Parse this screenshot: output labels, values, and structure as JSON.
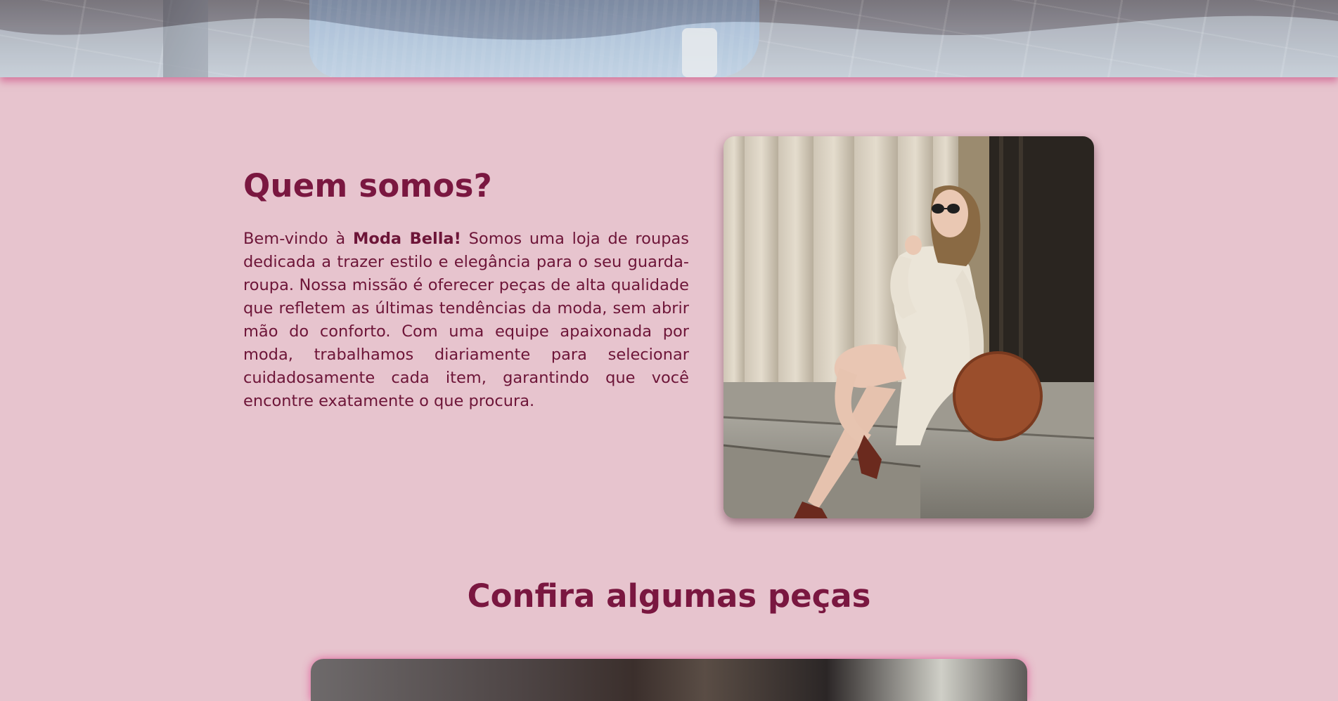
{
  "about": {
    "title": "Quem somos?",
    "text_before": "Bem-vindo à ",
    "brand": "Moda Bella!",
    "text_after": " Somos uma loja de roupas dedicada a trazer estilo e elegância para o seu guarda-roupa. Nossa missão é oferecer peças de alta qualidade que refletem as últimas tendências da moda, sem abrir mão do conforto. Com uma equipe apaixonada por moda, trabalhamos diariamente para selecionar cuidadosamente cada item, garantindo que você encontre exatamente o que procura."
  },
  "products": {
    "title": "Confira algumas peças"
  },
  "colors": {
    "background": "#e7c4ce",
    "heading": "#7a1740",
    "text": "#6d1538",
    "glow": "#dc468c"
  }
}
